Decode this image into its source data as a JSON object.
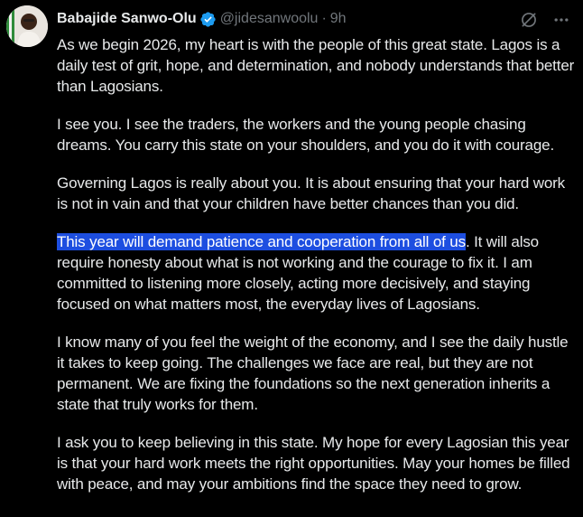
{
  "tweet": {
    "author": {
      "display_name": "Babajide Sanwo-Olu",
      "handle": "@jidesanwoolu",
      "verified": true,
      "avatar_icon": "profile-photo"
    },
    "separator": "·",
    "time": "9h",
    "actions": {
      "grok_icon": "grok-slash-icon",
      "more_icon": "more-horizontal-icon"
    },
    "paragraphs": [
      "As we begin 2026, my heart is with the people of this great state. Lagos is a daily test of grit, hope, and determination, and nobody understands that better than Lagosians.",
      "I see you. I see the traders, the workers and the young people chasing dreams. You carry this state on your shoulders, and you do it with courage.",
      "Governing Lagos is really about you. It is about ensuring that your hard work is not in vain and that your children have better chances than you did.",
      "I know many of you feel the weight of the economy, and I see the daily hustle it takes to keep going. The challenges we face are real, but they are not permanent. We are fixing the foundations so the next generation inherits a state that truly works for them.",
      "I ask you to keep believing in this state. My hope for every Lagosian this year is that your hard work meets the right opportunities. May your homes be filled with peace, and may your ambitions find the space they need to grow."
    ],
    "highlighted_paragraph": {
      "highlighted_text": "This year will demand patience and cooperation from all of us",
      "rest_text": ". It will also require honesty about what is not working and the courage to fix it. I am committed to listening more closely, acting more decisively, and staying focused on what matters most, the everyday lives of Lagosians."
    }
  },
  "colors": {
    "background": "#000000",
    "text": "#e7e9ea",
    "muted": "#71767b",
    "verified": "#1d9bf0",
    "selection": "#1d4ee0"
  }
}
